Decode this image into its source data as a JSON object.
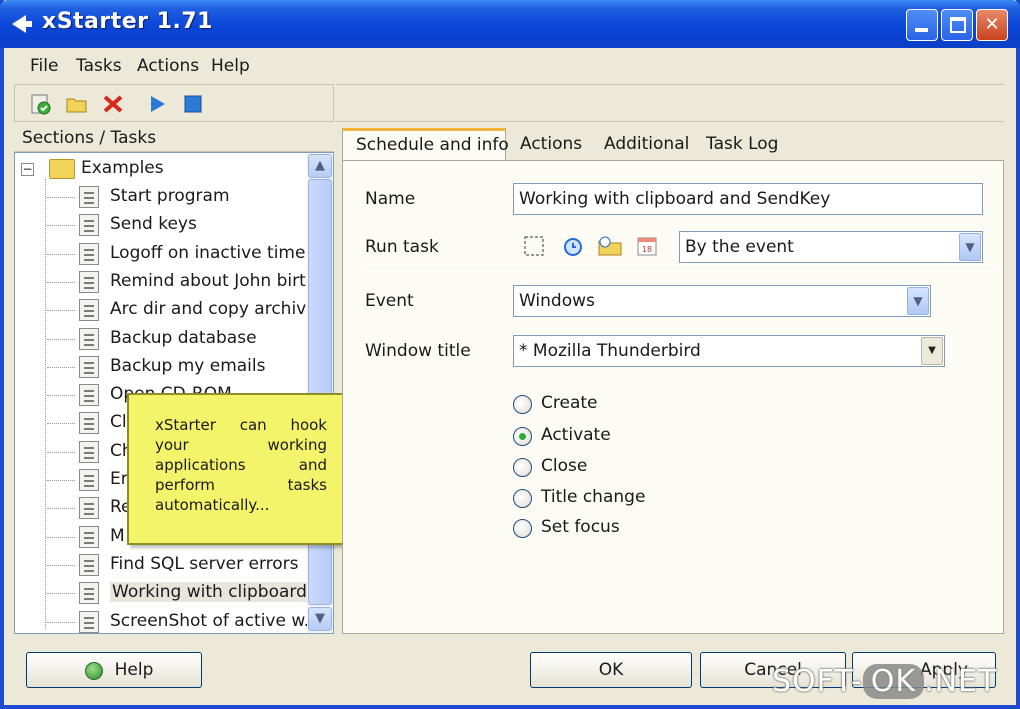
{
  "window": {
    "title": "xStarter 1.71"
  },
  "menu": [
    "File",
    "Tasks",
    "Actions",
    "Help"
  ],
  "toolbar": [
    "new-task-icon",
    "folder-icon",
    "delete-icon",
    "run-icon",
    "stop-icon"
  ],
  "left_panel": {
    "header": "Sections / Tasks",
    "root": "Examples",
    "items": [
      "Start program",
      "Send keys",
      "Logoff on inactive time",
      "Remind about John birt...",
      "Arc dir and copy archive",
      "Backup database",
      "Backup my emails",
      "Open CD-ROM",
      "Cl",
      "Ch",
      "Er",
      "Re",
      "M",
      "Find SQL server errors",
      "Working with clipboard ...",
      "ScreenShot of active w..."
    ],
    "selected_index": 14
  },
  "callout": {
    "text": "xStarter can hook your working applications and perform tasks automatically..."
  },
  "tabs": [
    "Schedule and info",
    "Actions",
    "Additional",
    "Task Log"
  ],
  "active_tab": 0,
  "form": {
    "name_label": "Name",
    "name_value": "Working with clipboard and SendKey",
    "run_task_label": "Run task",
    "run_task_value": "By the event",
    "event_label": "Event",
    "event_value": "Windows",
    "window_title_label": "Window title",
    "window_title_value": "* Mozilla Thunderbird",
    "radios": [
      "Create",
      "Activate",
      "Close",
      "Title change",
      "Set focus"
    ],
    "selected_radio": 1
  },
  "buttons": {
    "help": "Help",
    "ok": "OK",
    "cancel": "Cancel",
    "apply": "Apply"
  },
  "watermark": {
    "left": "SOFT-",
    "mid": "OK",
    "right": ".NET"
  }
}
